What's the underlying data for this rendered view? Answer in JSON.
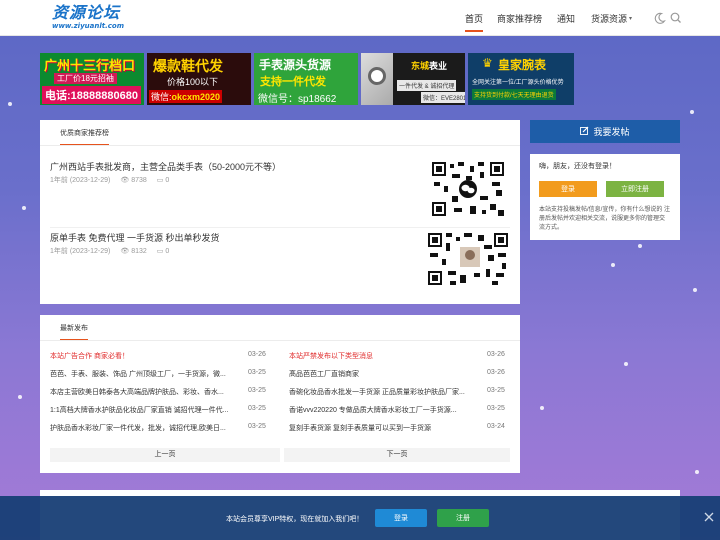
{
  "header": {
    "logo_main": "资源论坛",
    "logo_sub": "www.ziyuanlt.com",
    "nav": [
      {
        "label": "首页"
      },
      {
        "label": "商家推荐榜"
      },
      {
        "label": "通知"
      },
      {
        "label": "货源资源"
      }
    ],
    "nav_caret": "▾",
    "icons": [
      "moon-icon",
      "search-icon"
    ]
  },
  "banners": [
    {
      "line1": "广州十三行档口",
      "line2": "工厂价18元招袖",
      "line3": "电话:18888880680"
    },
    {
      "line1": "爆款鞋代发",
      "line2": "价格100以下",
      "line3_prefix": "微信:",
      "line3_value": "okcxm2020"
    },
    {
      "line1": "手表源头货源",
      "line2": "支持一件代发",
      "line3": "微信号：sp18662"
    },
    {
      "line1_prefix": "东城",
      "line1_suffix": "表业",
      "tag1": "一件代发 & 诚招代理",
      "tag2": "微信：EVE28011"
    },
    {
      "line1": "皇家腕表",
      "line2": "全网关注第一位/工厂源头价格优势",
      "line3": "支持货到付款/七天无理由退货"
    }
  ],
  "recommended": {
    "title": "优质商家推荐榜",
    "posts": [
      {
        "title": "广州西站手表批发商，主营全品类手表（50-2000元不等）",
        "time": "1年前 (2023-12-29)",
        "views": "8738",
        "comments": "0"
      },
      {
        "title": "原单手表 免费代理 一手货源 秒出单秒发货",
        "time": "1年前 (2023-12-29)",
        "views": "8132",
        "comments": "0"
      }
    ]
  },
  "latest": {
    "title": "最新发布",
    "left": [
      {
        "text": "本站广告合作 商家必看！",
        "date": "03-26",
        "highlight": true
      },
      {
        "text": "芭芭、手表、服装、饰品 广州顶级工厂，一手货源，微...",
        "date": "03-25",
        "highlight": false
      },
      {
        "text": "本店主营欧美日韩泰各大高端品牌护肤品、彩妆、香水...",
        "date": "03-25",
        "highlight": false
      },
      {
        "text": "1:1高档大牌香水护肤品化妆品厂家直销 诚招代理一件代...",
        "date": "03-25",
        "highlight": false
      },
      {
        "text": "护肤品香水彩妆厂家一件代发，批发，诚招代理,欧美日...",
        "date": "03-25",
        "highlight": false
      }
    ],
    "right": [
      {
        "text": "本站严禁发布以下类型消息",
        "date": "03-26",
        "highlight": true
      },
      {
        "text": "髙品芭芭工厂直销商家",
        "date": "03-26",
        "highlight": false
      },
      {
        "text": "香碗化妆品香水批发一手货源 正品质量彩妆护肤品厂家...",
        "date": "03-25",
        "highlight": false
      },
      {
        "text": "香诺vvv220220 专做品质大牌香水彩妆工厂一手货源...",
        "date": "03-25",
        "highlight": false
      },
      {
        "text": "复刻手表货源 复刻手表质量可以买到一手货源",
        "date": "03-24",
        "highlight": false
      }
    ],
    "prev": "上一页",
    "next": "下一页"
  },
  "sidebar": {
    "post_button": "我要发帖",
    "greeting": "嗨，朋友，还没有登录！",
    "login": "登录",
    "register": "立即注册",
    "desc": "本站支持投稿发帖/信息/宣传，你有什么想说的 注册后发帖并欢迎相关交流，说服更多你的管理交 流方式。"
  },
  "footer": {
    "text": "本站会员尊享VIP特权，现在就加入我们吧！",
    "login": "登录",
    "register": "注册"
  },
  "colors": {
    "accent": "#e6531d",
    "brand_blue": "#1e5da8",
    "login_orange": "#f29b1d",
    "register_green": "#7cb342",
    "footer_login": "#1f8ad6",
    "footer_register": "#2fa14a"
  }
}
